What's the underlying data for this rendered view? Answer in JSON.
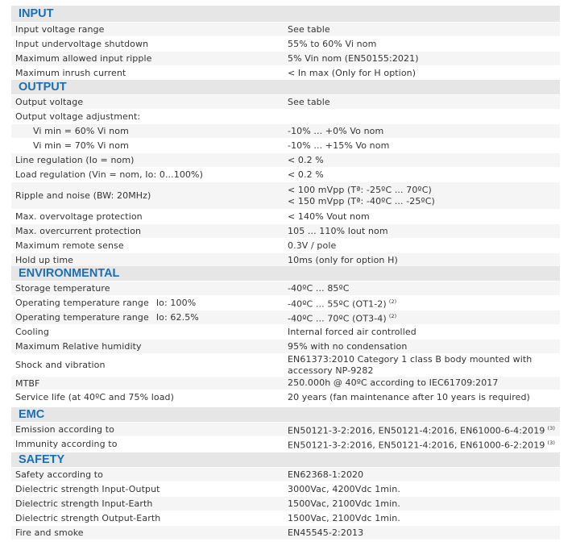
{
  "sections": [
    {
      "title": "INPUT",
      "rows": [
        {
          "label": "Input voltage range",
          "value": [
            "See table"
          ]
        },
        {
          "label": "Input undervoltage shutdown",
          "value": [
            "55% to 60% Vi nom"
          ]
        },
        {
          "label": "Maximum allowed input ripple",
          "value": [
            "5% Vin nom (EN50155:2021)"
          ]
        },
        {
          "label": "Maximum inrush current",
          "value": [
            "< In max (Only for H option)"
          ]
        }
      ]
    },
    {
      "title": "OUTPUT",
      "rows": [
        {
          "label": "Output voltage",
          "value": [
            "See table"
          ]
        },
        {
          "label": "Output voltage adjustment:",
          "value": [
            ""
          ]
        },
        {
          "label": "Vi min = 60% Vi nom",
          "indent": true,
          "value": [
            "-10% ... +0% Vo nom"
          ]
        },
        {
          "label": "Vi min = 70% Vi nom",
          "indent": true,
          "value": [
            "-10% ... +15% Vo nom"
          ]
        },
        {
          "label": "Line regulation (Io = nom)",
          "value": [
            "< 0.2 %"
          ]
        },
        {
          "label": "Load regulation (Vin = nom, Io: 0...100%)",
          "value": [
            "< 0.2 %"
          ]
        },
        {
          "label": "Ripple and noise (BW: 20MHz)",
          "value": [
            "< 100 mVpp (Tª: -25ºC ... 70ºC)",
            "< 150 mVpp (Tª: -40ºC ... -25ºC)"
          ]
        },
        {
          "label": "Max. overvoltage protection",
          "value": [
            "< 140% Vout nom"
          ]
        },
        {
          "label": "Max. overcurrent protection",
          "value": [
            "105 ... 110% Iout nom"
          ]
        },
        {
          "label": "Maximum remote sense",
          "value": [
            "0.3V / pole"
          ]
        },
        {
          "label": "Hold up time",
          "value": [
            "10ms (only for option H)"
          ]
        }
      ]
    },
    {
      "title": "ENVIRONMENTAL",
      "rows": [
        {
          "label": "Storage temperature",
          "value": [
            "-40ºC ... 85ºC"
          ]
        },
        {
          "label": "Operating temperature range",
          "sublabel": "Io: 100%",
          "value": [
            "-40ºC ... 55ºC (OT1-2)"
          ],
          "note": "(2)"
        },
        {
          "label": "Operating temperature range",
          "sublabel": "Io: 62.5%",
          "value": [
            "-40ºC ... 70ºC (OT3-4)"
          ],
          "note": "(2)"
        },
        {
          "label": "Cooling",
          "value": [
            "Internal forced air controlled"
          ]
        },
        {
          "label": "Maximum Relative humidity",
          "value": [
            "95% with no condensation"
          ]
        },
        {
          "label": "Shock and vibration",
          "value": [
            "EN61373:2010 Category 1 class B body mounted with",
            "accessory NP-9282"
          ]
        },
        {
          "label": "MTBF",
          "value": [
            "250.000h @ 40ºC according to IEC61709:2017"
          ]
        },
        {
          "label": "Service life (at 40ºC and 75% load)",
          "value": [
            "20 years (fan maintenance after 10 years is required)"
          ]
        }
      ]
    },
    {
      "title": "EMC",
      "rows": [
        {
          "label": "Emission according to",
          "value": [
            "EN50121-3-2:2016, EN50121-4:2016, EN61000-6-4:2019"
          ],
          "note": "(3)"
        },
        {
          "label": "Immunity according to",
          "value": [
            "EN50121-3-2:2016, EN50121-4:2016, EN61000-6-2:2019"
          ],
          "note": "(3)"
        }
      ]
    },
    {
      "title": "SAFETY",
      "rows": [
        {
          "label": "Safety according to",
          "value": [
            "EN62368-1:2020"
          ]
        },
        {
          "label": "Dielectric strength Input-Output",
          "value": [
            "3000Vac, 4200Vdc 1min."
          ]
        },
        {
          "label": "Dielectric strength Input-Earth",
          "value": [
            "1500Vac, 2100Vdc 1min."
          ]
        },
        {
          "label": "Dielectric strength Output-Earth",
          "value": [
            "1500Vac, 2100Vdc 1min."
          ]
        },
        {
          "label": "Fire and smoke",
          "value": [
            "EN45545-2:2013"
          ]
        }
      ]
    }
  ]
}
